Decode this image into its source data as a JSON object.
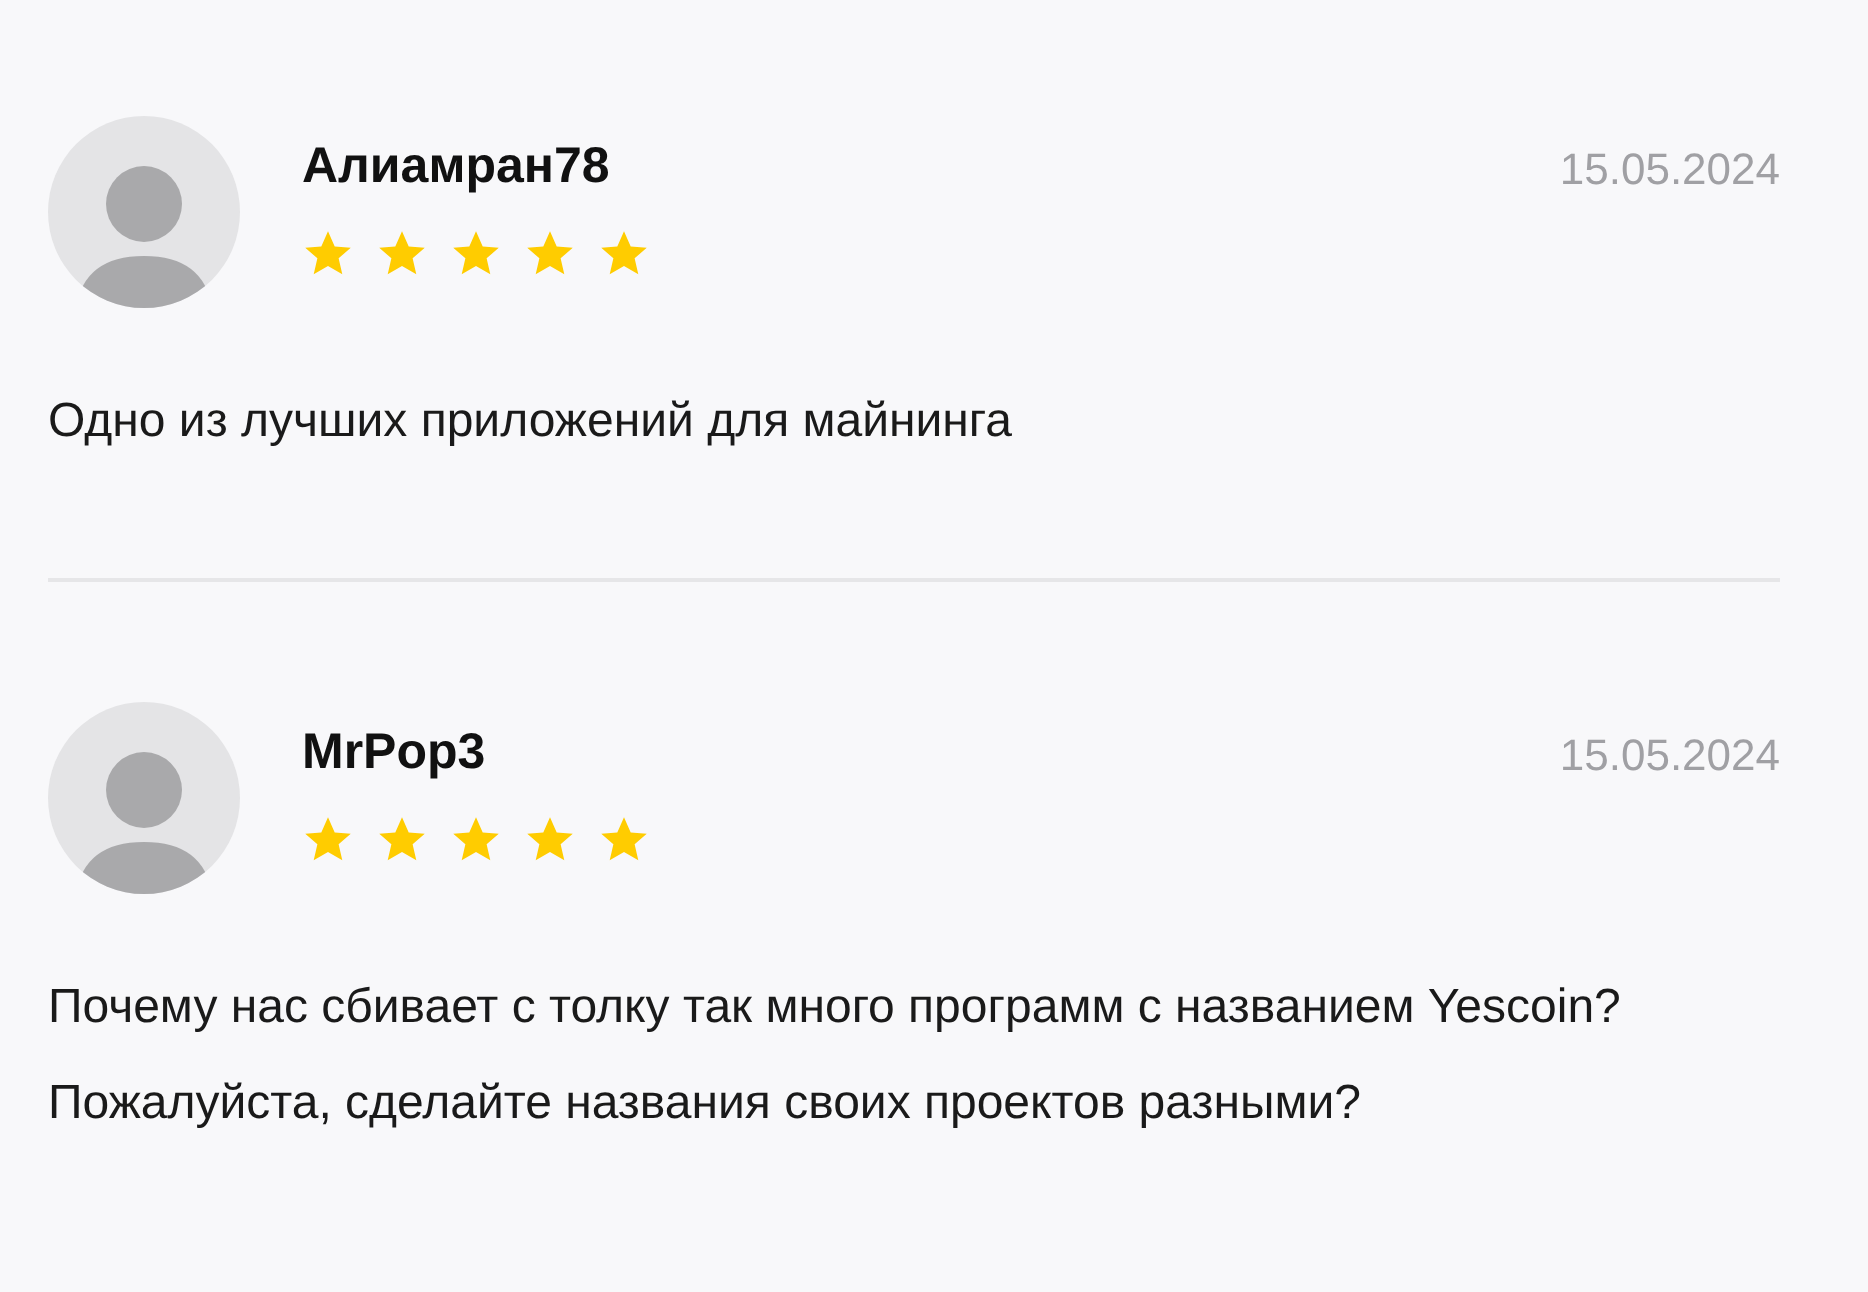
{
  "reviews": [
    {
      "author": "Алиамран78",
      "date": "15.05.2024",
      "stars": 5,
      "text": "Одно из лучших приложений для майнинга"
    },
    {
      "author": "MrPop3",
      "date": "15.05.2024",
      "stars": 5,
      "text": "Почему нас сбивает с толку так много программ с названием Yescoin? Пожалуйста, сделайте названия своих проектов разными?"
    }
  ]
}
